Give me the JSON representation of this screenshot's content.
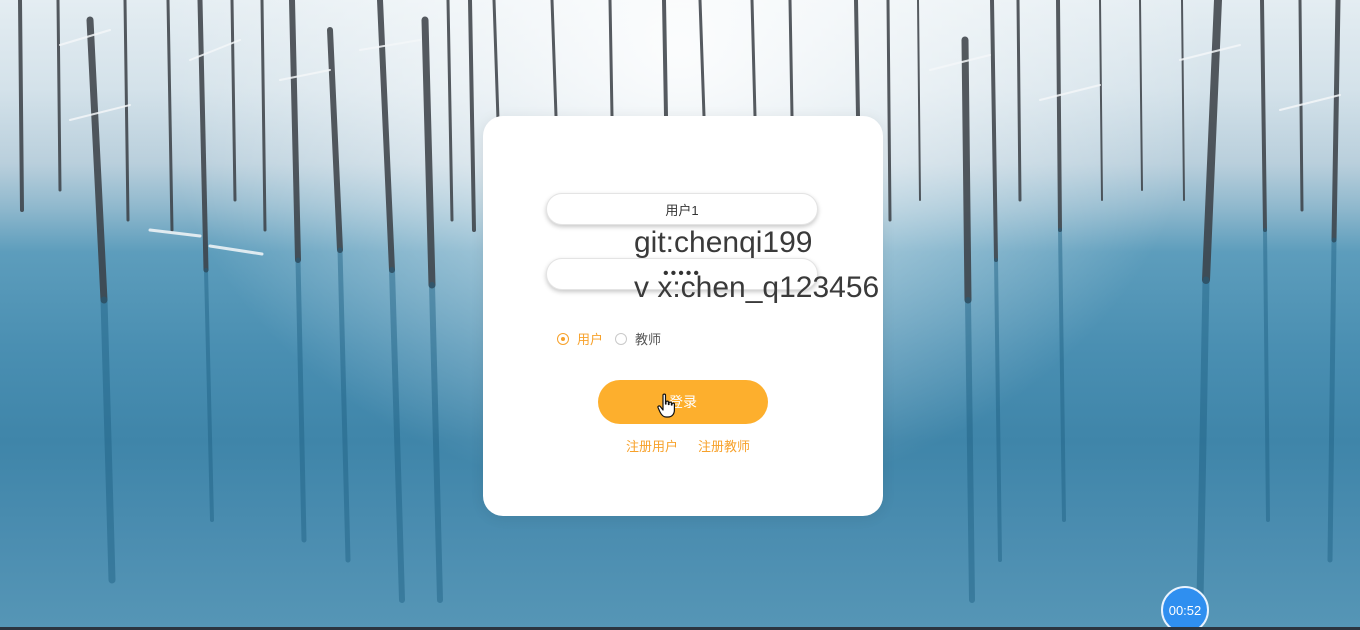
{
  "login": {
    "username_value": "用户1",
    "password_value": "•••••",
    "role_options": [
      {
        "label": "用户",
        "selected": true
      },
      {
        "label": "教师",
        "selected": false
      }
    ],
    "submit_label": "登录",
    "links": [
      {
        "label": "注册用户"
      },
      {
        "label": "注册教师"
      }
    ]
  },
  "overlay": {
    "watermark_line1": "git:chenqi199",
    "watermark_line2": "v x:chen_q123456",
    "timer": "00:52"
  },
  "colors": {
    "accent": "#fdaf2d",
    "link": "#f7a12a",
    "card": "#ffffff",
    "timer_badge": "#2f8ff0"
  },
  "icons": {
    "cursor": "hand-pointer-icon"
  }
}
